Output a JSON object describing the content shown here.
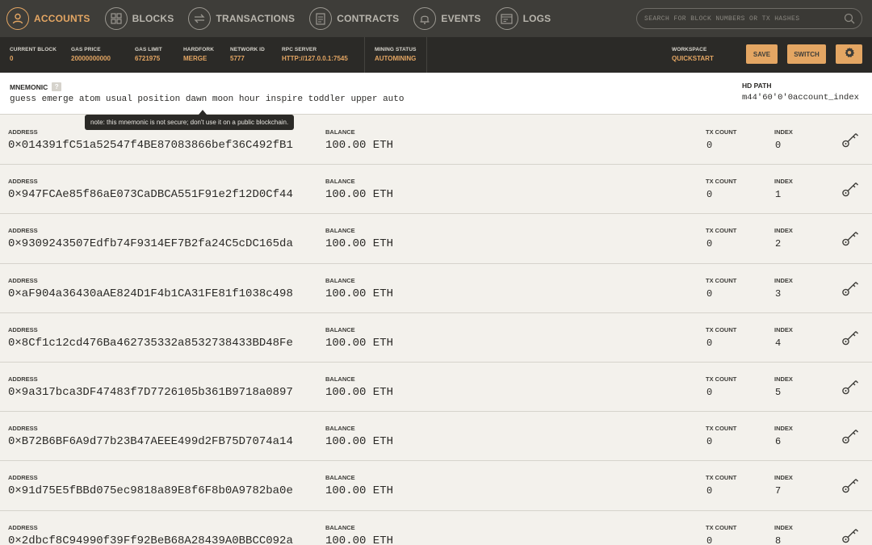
{
  "nav": {
    "items": [
      {
        "label": "ACCOUNTS",
        "icon": "accounts-icon",
        "active": true
      },
      {
        "label": "BLOCKS",
        "icon": "blocks-icon",
        "active": false
      },
      {
        "label": "TRANSACTIONS",
        "icon": "transactions-icon",
        "active": false
      },
      {
        "label": "CONTRACTS",
        "icon": "contracts-icon",
        "active": false
      },
      {
        "label": "EVENTS",
        "icon": "events-icon",
        "active": false
      },
      {
        "label": "LOGS",
        "icon": "logs-icon",
        "active": false
      }
    ],
    "search_placeholder": "SEARCH FOR BLOCK NUMBERS OR TX HASHES"
  },
  "status": {
    "current_block": {
      "label": "CURRENT BLOCK",
      "value": "0"
    },
    "gas_price": {
      "label": "GAS PRICE",
      "value": "20000000000"
    },
    "gas_limit": {
      "label": "GAS LIMIT",
      "value": "6721975"
    },
    "hardfork": {
      "label": "HARDFORK",
      "value": "MERGE"
    },
    "network_id": {
      "label": "NETWORK ID",
      "value": "5777"
    },
    "rpc_server": {
      "label": "RPC SERVER",
      "value": "HTTP://127.0.0.1:7545"
    },
    "mining_status": {
      "label": "MINING STATUS",
      "value": "AUTOMINING"
    },
    "workspace": {
      "label": "WORKSPACE",
      "value": "QUICKSTART"
    },
    "save_label": "SAVE",
    "switch_label": "SWITCH"
  },
  "mnemonic": {
    "title": "MNEMONIC",
    "help": "?",
    "words": "guess emerge atom usual position dawn moon hour inspire toddler upper auto",
    "tooltip": "note: this mnemonic is not secure; don't use it on a public blockchain.",
    "hd_path_label": "HD PATH",
    "hd_path_value": "m44'60'0'0account_index"
  },
  "labels": {
    "address": "ADDRESS",
    "balance": "BALANCE",
    "tx_count": "TX COUNT",
    "index": "INDEX"
  },
  "accounts": [
    {
      "address": "0×014391fC51a52547f4BE87083866bef36C492fB1",
      "balance": "100.00 ETH",
      "tx_count": "0",
      "index": "0"
    },
    {
      "address": "0×947FCAe85f86aE073CaDBCA551F91e2f12D0Cf44",
      "balance": "100.00 ETH",
      "tx_count": "0",
      "index": "1"
    },
    {
      "address": "0×9309243507Edfb74F9314EF7B2fa24C5cDC165da",
      "balance": "100.00 ETH",
      "tx_count": "0",
      "index": "2"
    },
    {
      "address": "0×aF904a36430aAE824D1F4b1CA31FE81f1038c498",
      "balance": "100.00 ETH",
      "tx_count": "0",
      "index": "3"
    },
    {
      "address": "0×8Cf1c12cd476Ba462735332a8532738433BD48Fe",
      "balance": "100.00 ETH",
      "tx_count": "0",
      "index": "4"
    },
    {
      "address": "0×9a317bca3DF47483f7D7726105b361B9718a0897",
      "balance": "100.00 ETH",
      "tx_count": "0",
      "index": "5"
    },
    {
      "address": "0×B72B6BF6A9d77b23B47AEEE499d2FB75D7074a14",
      "balance": "100.00 ETH",
      "tx_count": "0",
      "index": "6"
    },
    {
      "address": "0×91d75E5fBBd075ec9818a89E8f6F8b0A9782ba0e",
      "balance": "100.00 ETH",
      "tx_count": "0",
      "index": "7"
    },
    {
      "address": "0×2dbcf8C94990f39Ff92BeB68A28439A0BBCC092a",
      "balance": "100.00 ETH",
      "tx_count": "0",
      "index": "8"
    }
  ],
  "colors": {
    "accent": "#e4a663",
    "nav_bg": "#3e3d39",
    "status_bg": "#2b2a27",
    "page_bg": "#f3f1ec"
  }
}
